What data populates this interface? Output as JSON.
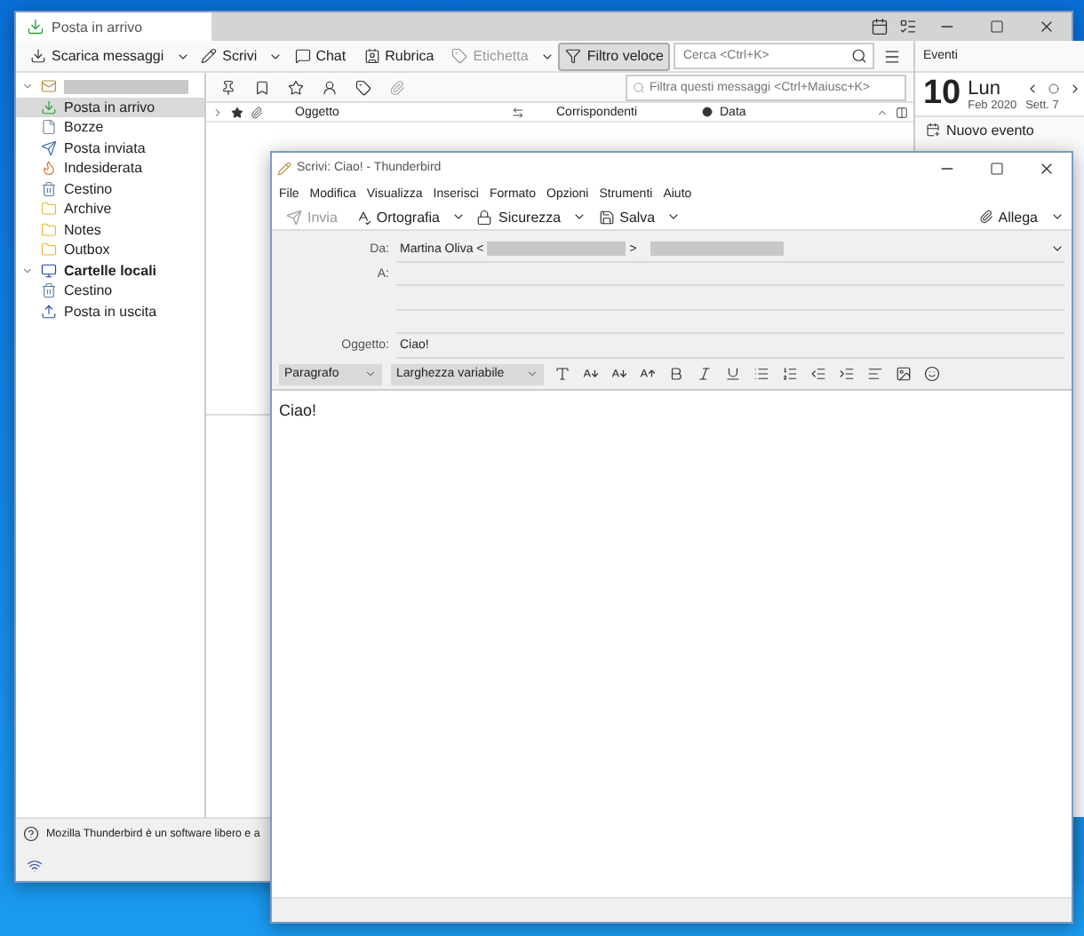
{
  "main_window": {
    "tab": "Posta in arrivo",
    "toolbar": [
      {
        "kind": "download",
        "label": "Scarica messaggi",
        "menu": true,
        "disabled": false,
        "selected": false
      },
      {
        "kind": "pencil",
        "label": "Scrivi",
        "menu": true,
        "disabled": false,
        "selected": false
      },
      {
        "kind": "chat",
        "label": "Chat",
        "menu": false,
        "disabled": false,
        "selected": false
      },
      {
        "kind": "contact",
        "label": "Rubrica",
        "menu": false,
        "disabled": false,
        "selected": false
      },
      {
        "kind": "tag",
        "label": "Etichetta",
        "menu": true,
        "disabled": true,
        "selected": false
      },
      {
        "kind": "filter",
        "label": "Filtro veloce",
        "menu": false,
        "disabled": false,
        "selected": true
      }
    ],
    "search": {
      "placeholder": "Cerca <Ctrl+K>"
    },
    "folders": [
      {
        "kind": "account",
        "expanded": true,
        "selected": false,
        "children": [
          {
            "kind": "inbox",
            "label": "Posta in arrivo",
            "selected": true
          },
          {
            "kind": "drafts",
            "label": "Bozze",
            "selected": false
          },
          {
            "kind": "sent",
            "label": "Posta inviata",
            "selected": false
          },
          {
            "kind": "junk",
            "label": "Indesiderata",
            "selected": false
          },
          {
            "kind": "trash",
            "label": "Cestino",
            "selected": false
          },
          {
            "kind": "folder",
            "label": "Archive",
            "selected": false
          },
          {
            "kind": "folder",
            "label": "Notes",
            "selected": false
          },
          {
            "kind": "folder",
            "label": "Outbox",
            "selected": false
          }
        ]
      },
      {
        "kind": "local",
        "label": "Cartelle locali",
        "expanded": true,
        "selected": false,
        "children": [
          {
            "kind": "trash",
            "label": "Cestino",
            "selected": false
          },
          {
            "kind": "outbox",
            "label": "Posta in uscita",
            "selected": false
          }
        ]
      }
    ],
    "filter": {
      "placeholder": "Filtra questi messaggi <Ctrl+Maiusc+K>"
    },
    "columns": [
      "Oggetto",
      "Corrispondenti",
      "Data"
    ],
    "events": {
      "title": "Eventi",
      "day": "10",
      "weekday": "Lun",
      "month": "Feb 2020",
      "week": "Sett. 7",
      "new_event": "Nuovo evento"
    },
    "status": "Mozilla Thunderbird è un software libero e a"
  },
  "compose_window": {
    "title": "Scrivi: Ciao! - Thunderbird",
    "menu": [
      "File",
      "Modifica",
      "Visualizza",
      "Inserisci",
      "Formato",
      "Opzioni",
      "Strumenti",
      "Aiuto"
    ],
    "toolbar": [
      {
        "kind": "send",
        "label": "Invia",
        "menu": false,
        "disabled": true
      },
      {
        "kind": "spell",
        "label": "Ortografia",
        "menu": true,
        "disabled": false
      },
      {
        "kind": "lock",
        "label": "Sicurezza",
        "menu": true,
        "disabled": false
      },
      {
        "kind": "save",
        "label": "Salva",
        "menu": true,
        "disabled": false
      }
    ],
    "attach": "Allega",
    "from_label": "Da:",
    "from_value": "Martina Oliva <",
    "from_close": ">",
    "to_label": "A:",
    "subject_label": "Oggetto:",
    "subject_value": "Ciao!",
    "paragraph": "Paragrafo",
    "font": "Larghezza variabile",
    "body": "Ciao!"
  }
}
